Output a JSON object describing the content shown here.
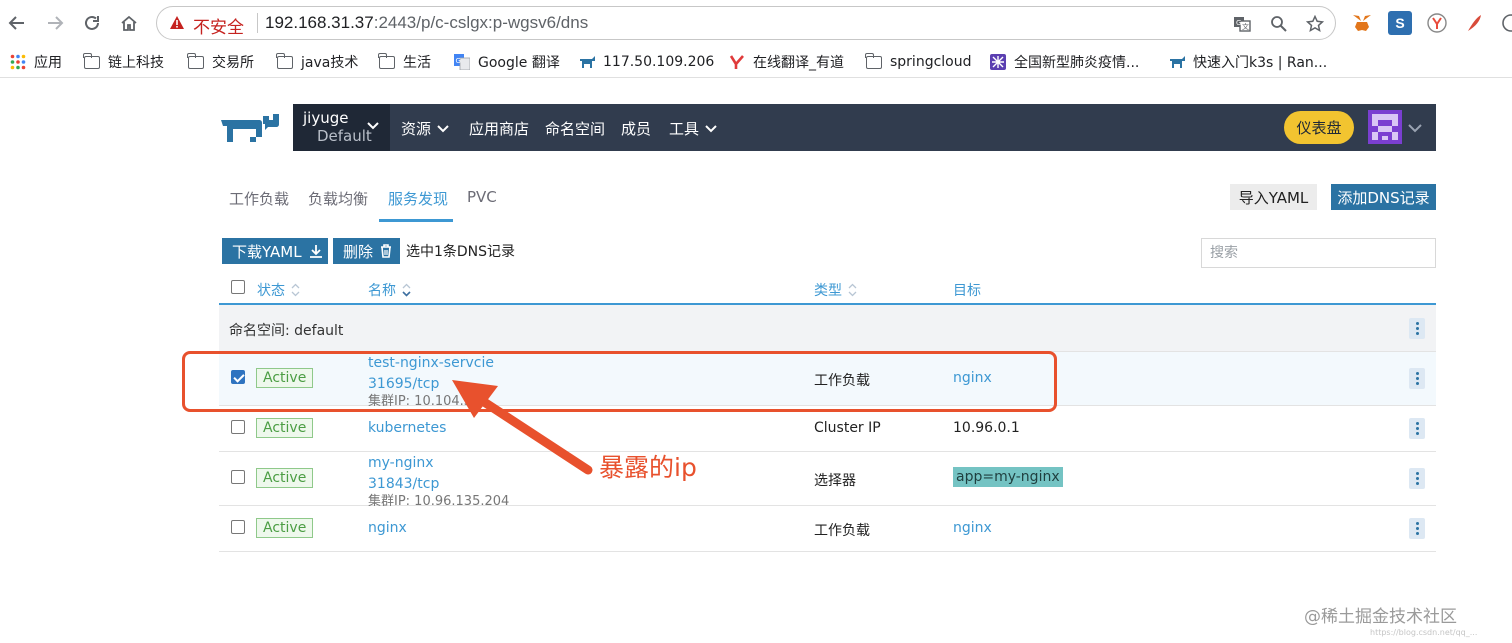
{
  "browser": {
    "security_label": "不安全",
    "url_host": "192.168.31.37",
    "url_rest": ":2443/p/c-cslgx:p-wgsv6/dns"
  },
  "bookmarks": [
    {
      "label": "应用",
      "icon": "apps-grid-icon"
    },
    {
      "label": "链上科技",
      "icon": "folder-icon"
    },
    {
      "label": "交易所",
      "icon": "folder-icon"
    },
    {
      "label": "java技术",
      "icon": "folder-icon"
    },
    {
      "label": "生活",
      "icon": "folder-icon"
    },
    {
      "label": "Google 翻译",
      "icon": "google-translate-icon"
    },
    {
      "label": "117.50.109.206",
      "icon": "rancher-icon"
    },
    {
      "label": "在线翻译_有道",
      "icon": "youdao-icon"
    },
    {
      "label": "springcloud",
      "icon": "folder-icon"
    },
    {
      "label": "全国新型肺炎疫情...",
      "icon": "bookmark-app-icon"
    },
    {
      "label": "快速入门k3s | Ran...",
      "icon": "rancher-icon"
    }
  ],
  "rancher": {
    "cluster_name": "jiyuge",
    "project_name": "Default",
    "nav": [
      {
        "label": "资源",
        "has_dropdown": true
      },
      {
        "label": "应用商店",
        "has_dropdown": false
      },
      {
        "label": "命名空间",
        "has_dropdown": false
      },
      {
        "label": "成员",
        "has_dropdown": false
      },
      {
        "label": "工具",
        "has_dropdown": true
      }
    ],
    "dashboard_label": "仪表盘"
  },
  "tabs": [
    {
      "label": "工作负载",
      "active": false
    },
    {
      "label": "负载均衡",
      "active": false
    },
    {
      "label": "服务发现",
      "active": true
    },
    {
      "label": "PVC",
      "active": false
    }
  ],
  "actions": {
    "import_yaml": "导入YAML",
    "add_dns": "添加DNS记录",
    "download_yaml": "下载YAML",
    "delete": "删除",
    "selected_text": "选中1条DNS记录",
    "search_placeholder": "搜索"
  },
  "table": {
    "columns": {
      "state": "状态",
      "name": "名称",
      "type": "类型",
      "target": "目标"
    },
    "group_label": "命名空间: default",
    "rows": [
      {
        "checked": true,
        "state": "Active",
        "name": "test-nginx-servcie",
        "port": "31695/tcp",
        "cluster_ip": "集群IP: 10.104.5",
        "type": "工作负载",
        "target": "nginx",
        "target_style": "link"
      },
      {
        "checked": false,
        "state": "Active",
        "name": "kubernetes",
        "port": "",
        "cluster_ip": "",
        "type": "Cluster IP",
        "target": "10.96.0.1",
        "target_style": "plain"
      },
      {
        "checked": false,
        "state": "Active",
        "name": "my-nginx",
        "port": "31843/tcp",
        "cluster_ip": "集群IP: 10.96.135.204",
        "type": "选择器",
        "target": "app=my-nginx",
        "target_style": "selector"
      },
      {
        "checked": false,
        "state": "Active",
        "name": "nginx",
        "port": "",
        "cluster_ip": "",
        "type": "工作负载",
        "target": "nginx",
        "target_style": "link"
      }
    ]
  },
  "annotation": {
    "label": "暴露的ip",
    "color": "#e8512d"
  },
  "watermark": {
    "text": "@稀土掘金技术社区",
    "sub": "https://blog.csdn.net/qq_..."
  },
  "colors": {
    "accent": "#3d98d3",
    "primary_button": "#2b73a3",
    "nav_bg": "#313c4e",
    "dashboard": "#f2c430"
  }
}
